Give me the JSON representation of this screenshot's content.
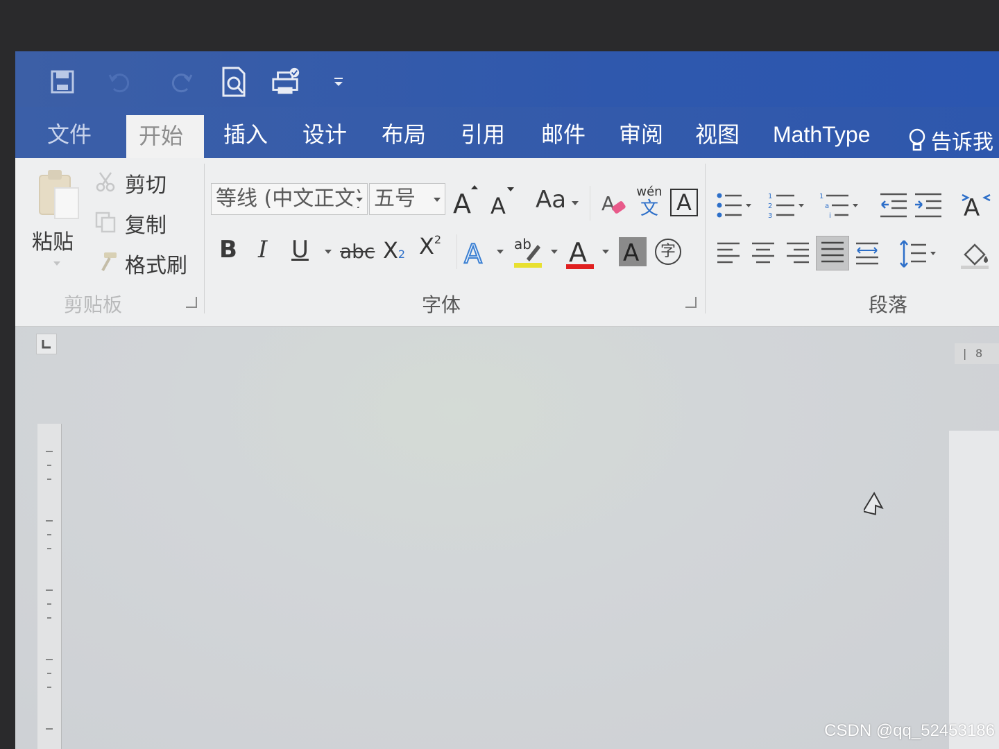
{
  "tabs": [
    {
      "label": "文件",
      "state": "file"
    },
    {
      "label": "开始",
      "state": "active"
    },
    {
      "label": "插入"
    },
    {
      "label": "设计"
    },
    {
      "label": "布局"
    },
    {
      "label": "引用"
    },
    {
      "label": "邮件"
    },
    {
      "label": "审阅"
    },
    {
      "label": "视图"
    },
    {
      "label": "MathType"
    },
    {
      "label": "告诉我"
    }
  ],
  "clipboard": {
    "paste": "粘贴",
    "cut": "剪切",
    "copy": "复制",
    "format_painter": "格式刷",
    "group_label": "剪贴板"
  },
  "font": {
    "font_name": "等线 (中文正文)",
    "font_size": "五号",
    "change_case": "Aa",
    "bold": "B",
    "italic": "I",
    "underline": "U",
    "strikethrough": "abc",
    "subscript": "X",
    "subscript_mark": "2",
    "superscript": "X",
    "superscript_mark": "2",
    "phonetic_top": "wén",
    "phonetic_char": "文",
    "border_char": "A",
    "enclose_char": "字",
    "group_label": "字体"
  },
  "paragraph": {
    "group_label": "段落"
  },
  "ruler": {
    "h_number": "8"
  },
  "watermark": "CSDN @qq_52453186",
  "colors": {
    "title_bar": "#2f58ad",
    "highlight": "#e8e030",
    "font_color": "#e02020"
  }
}
